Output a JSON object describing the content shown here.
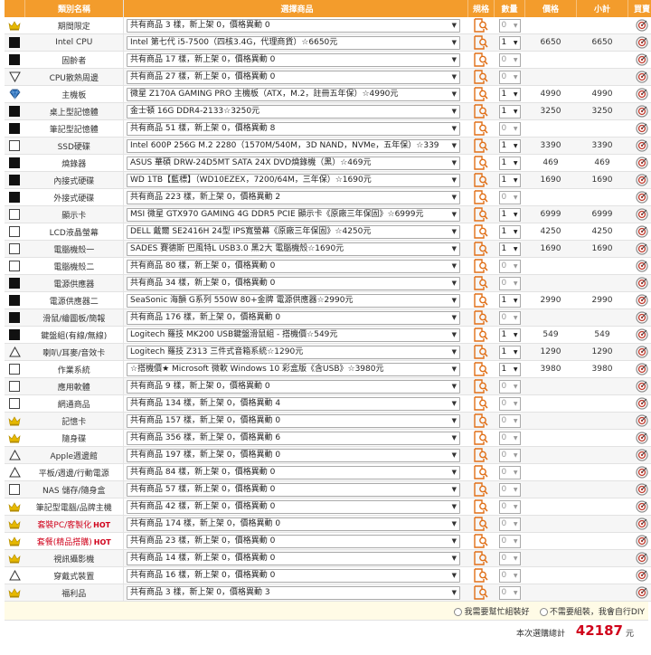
{
  "headers": {
    "name": "類別名稱",
    "select": "選擇商品",
    "spec": "規格",
    "qty": "數量",
    "price": "價格",
    "subtotal": "小計",
    "buy": "買賣"
  },
  "rows": [
    {
      "icon": "crown",
      "name": "期間限定",
      "select": "共有商品 3 樣，新上架 0，價格異動 0",
      "qty": "0",
      "price": "",
      "sub": ""
    },
    {
      "icon": "sq-black",
      "name": "Intel CPU",
      "select": "Intel 第七代 i5-7500（四核3.4G，代理商貨）☆6650元",
      "qty": "1",
      "price": "6650",
      "sub": "6650"
    },
    {
      "icon": "sq-black",
      "name": "固齡者",
      "select": "共有商品 17 樣，新上架 0，價格異動 0",
      "qty": "0",
      "price": "",
      "sub": ""
    },
    {
      "icon": "tri-down",
      "name": "CPU散熱周邊",
      "select": "共有商品 27 樣，新上架 0，價格異動 0",
      "qty": "0",
      "price": "",
      "sub": ""
    },
    {
      "icon": "diamond",
      "name": "主機板",
      "select": "微星 Z170A GAMING PRO 主機板（ATX，M.2，註冊五年保）☆4990元",
      "qty": "1",
      "price": "4990",
      "sub": "4990"
    },
    {
      "icon": "sq-black",
      "name": "桌上型記憶體",
      "select": "金士頓 16G DDR4-2133☆3250元",
      "qty": "1",
      "price": "3250",
      "sub": "3250"
    },
    {
      "icon": "sq-black",
      "name": "筆記型記憶體",
      "select": "共有商品 51 樣，新上架 0，價格異動 8",
      "qty": "0",
      "price": "",
      "sub": ""
    },
    {
      "icon": "sq-white",
      "name": "SSD硬碟",
      "select": "Intel 600P 256G M.2 2280（1570M/540M，3D NAND，NVMe，五年保）☆339",
      "qty": "1",
      "price": "3390",
      "sub": "3390"
    },
    {
      "icon": "sq-black",
      "name": "燒錄器",
      "select": "ASUS 華碩 DRW-24D5MT SATA 24X DVD燒錄機（黑）☆469元",
      "qty": "1",
      "price": "469",
      "sub": "469"
    },
    {
      "icon": "sq-black",
      "name": "內接式硬碟",
      "select": "WD 1TB【藍標】（WD10EZEX，7200/64M，三年保）☆1690元",
      "qty": "1",
      "price": "1690",
      "sub": "1690"
    },
    {
      "icon": "sq-black",
      "name": "外接式硬碟",
      "select": "共有商品 223 樣，新上架 0，價格異動 2",
      "qty": "0",
      "price": "",
      "sub": ""
    },
    {
      "icon": "sq-white",
      "name": "顯示卡",
      "select": "MSI 微星 GTX970 GAMING 4G DDR5 PCIE 顯示卡《原廠三年保固》☆6999元",
      "qty": "1",
      "price": "6999",
      "sub": "6999"
    },
    {
      "icon": "sq-white",
      "name": "LCD液晶螢幕",
      "select": "DELL 戴爾 SE2416H 24型 IPS寬螢幕《原廠三年保固》☆4250元",
      "qty": "1",
      "price": "4250",
      "sub": "4250"
    },
    {
      "icon": "sq-white",
      "name": "電腦機殼一",
      "select": "SADES 賽德斯 巴風特L USB3.0 黑2大 電腦機殼☆1690元",
      "qty": "1",
      "price": "1690",
      "sub": "1690"
    },
    {
      "icon": "sq-white",
      "name": "電腦機殼二",
      "select": "共有商品 80 樣，新上架 0，價格異動 0",
      "qty": "0",
      "price": "",
      "sub": ""
    },
    {
      "icon": "sq-black",
      "name": "電源供應器",
      "select": "共有商品 34 樣，新上架 0，價格異動 0",
      "qty": "0",
      "price": "",
      "sub": ""
    },
    {
      "icon": "sq-black",
      "name": "電源供應器二",
      "select": "SeaSonic 海韻 G系列 550W 80+金牌 電源供應器☆2990元",
      "qty": "1",
      "price": "2990",
      "sub": "2990"
    },
    {
      "icon": "sq-black",
      "name": "滑鼠/繪圖板/簡報",
      "select": "共有商品 176 樣，新上架 0，價格異動 0",
      "qty": "0",
      "price": "",
      "sub": ""
    },
    {
      "icon": "sq-black",
      "name": "鍵盤組(有線/無線)",
      "select": "Logitech 羅技 MK200 USB鍵盤滑鼠組 - 搭機價☆549元",
      "qty": "1",
      "price": "549",
      "sub": "549"
    },
    {
      "icon": "tri-up",
      "name": "喇叭/耳麥/音效卡",
      "select": "Logitech 羅技 Z313 三件式音箱系統☆1290元",
      "qty": "1",
      "price": "1290",
      "sub": "1290"
    },
    {
      "icon": "sq-white",
      "name": "作業系統",
      "select": "☆搭機價★ Microsoft 微軟 Windows 10 彩盒版《含USB》☆3980元",
      "qty": "1",
      "price": "3980",
      "sub": "3980"
    },
    {
      "icon": "sq-white",
      "name": "應用軟體",
      "select": "共有商品 9 樣，新上架 0，價格異動 0",
      "qty": "0",
      "price": "",
      "sub": ""
    },
    {
      "icon": "sq-white",
      "name": "網通商品",
      "select": "共有商品 134 樣，新上架 0，價格異動 4",
      "qty": "0",
      "price": "",
      "sub": ""
    },
    {
      "icon": "crown",
      "name": "記憶卡",
      "select": "共有商品 157 樣，新上架 0，價格異動 0",
      "qty": "0",
      "price": "",
      "sub": ""
    },
    {
      "icon": "crown",
      "name": "隨身碟",
      "select": "共有商品 356 樣，新上架 0，價格異動 6",
      "qty": "0",
      "price": "",
      "sub": ""
    },
    {
      "icon": "tri-up",
      "name": "Apple週邊館",
      "select": "共有商品 197 樣，新上架 0，價格異動 0",
      "qty": "0",
      "price": "",
      "sub": ""
    },
    {
      "icon": "tri-up",
      "name": "平板/週邊/行動電源",
      "select": "共有商品 84 樣，新上架 0，價格異動 0",
      "qty": "0",
      "price": "",
      "sub": ""
    },
    {
      "icon": "sq-white",
      "name": "NAS 儲存/隨身盒",
      "select": "共有商品 57 樣，新上架 0，價格異動 0",
      "qty": "0",
      "price": "",
      "sub": ""
    },
    {
      "icon": "crown",
      "name": "筆記型電腦/品牌主機",
      "select": "共有商品 42 樣，新上架 0，價格異動 0",
      "qty": "0",
      "price": "",
      "sub": ""
    },
    {
      "icon": "crown",
      "name": "套裝PC/客製化",
      "hot": "HOT",
      "red": true,
      "select": "共有商品 174 樣，新上架 0，價格異動 0",
      "qty": "0",
      "price": "",
      "sub": ""
    },
    {
      "icon": "crown",
      "name": "套餐(精品搭購)",
      "hot": "HOT",
      "red": true,
      "select": "共有商品 23 樣，新上架 0，價格異動 0",
      "qty": "0",
      "price": "",
      "sub": ""
    },
    {
      "icon": "crown",
      "name": "視訊攝影機",
      "select": "共有商品 14 樣，新上架 0，價格異動 0",
      "qty": "0",
      "price": "",
      "sub": ""
    },
    {
      "icon": "tri-up",
      "name": "穿戴式裝置",
      "select": "共有商品 16 樣，新上架 0，價格異動 0",
      "qty": "0",
      "price": "",
      "sub": ""
    },
    {
      "icon": "crown",
      "name": "福利品",
      "select": "共有商品 3 樣，新上架 0，價格異動 3",
      "qty": "0",
      "price": "",
      "sub": ""
    }
  ],
  "footer": {
    "option_need_help": "我需要幫忙組裝好",
    "option_diy": "不需要組裝，我會自行DIY",
    "total_label": "本次選購總計",
    "total_value": "42187",
    "total_unit": "元"
  },
  "colors": {
    "header_bg": "#f39c2c",
    "price_red": "#d0021b",
    "crown": "#e6b800"
  }
}
